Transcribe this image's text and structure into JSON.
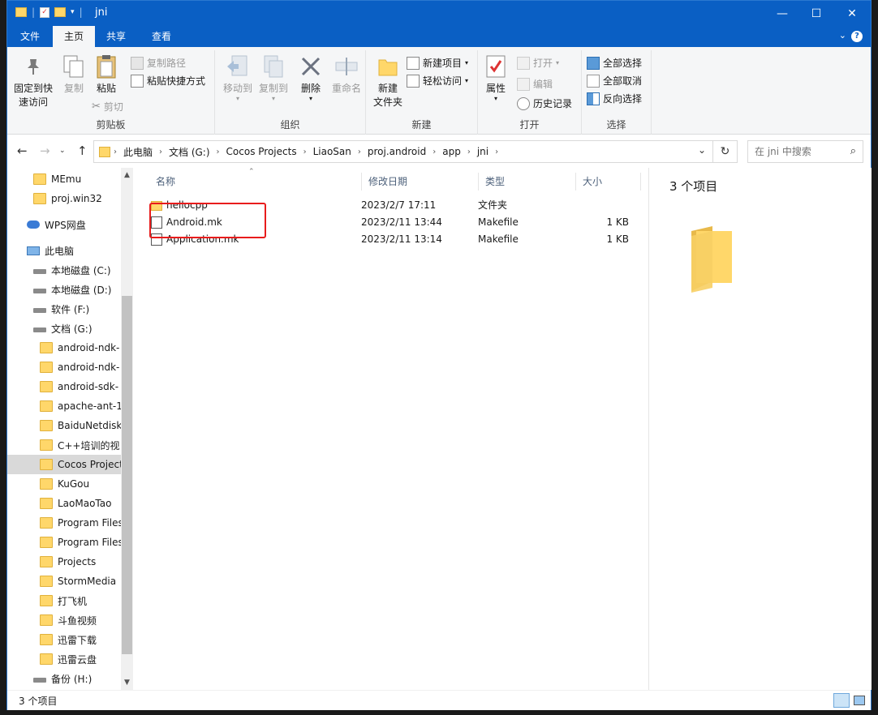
{
  "window": {
    "title": "jni",
    "controls": {
      "minimize": "—",
      "maximize": "☐",
      "close": "✕"
    }
  },
  "menu": {
    "tabs": [
      "文件",
      "主页",
      "共享",
      "查看"
    ],
    "active_tab": "主页"
  },
  "ribbon": {
    "clipboard": {
      "label": "剪贴板",
      "pin": "固定到快\n速访问",
      "pin_line1": "固定到快",
      "pin_line2": "速访问",
      "copy": "复制",
      "paste": "粘贴",
      "copy_path": "复制路径",
      "paste_shortcut": "粘贴快捷方式",
      "cut": "剪切"
    },
    "organize": {
      "label": "组织",
      "move_to": "移动到",
      "copy_to": "复制到",
      "delete": "删除",
      "rename": "重命名"
    },
    "new": {
      "label": "新建",
      "new_folder_line1": "新建",
      "new_folder_line2": "文件夹",
      "new_item": "新建项目",
      "easy_access": "轻松访问"
    },
    "open": {
      "label": "打开",
      "properties": "属性",
      "open": "打开",
      "edit": "编辑",
      "history": "历史记录"
    },
    "select": {
      "label": "选择",
      "select_all": "全部选择",
      "select_none": "全部取消",
      "invert": "反向选择"
    }
  },
  "address": {
    "breadcrumbs": [
      "此电脑",
      "文档 (G:)",
      "Cocos Projects",
      "LiaoSan",
      "proj.android",
      "app",
      "jni"
    ],
    "search_placeholder": "在 jni 中搜索"
  },
  "navpane": {
    "items": [
      {
        "label": "MEmu",
        "type": "folder",
        "indent": 1
      },
      {
        "label": "proj.win32",
        "type": "folder",
        "indent": 1
      },
      {
        "label": "WPS网盘",
        "type": "cloud",
        "indent": 0
      },
      {
        "label": "此电脑",
        "type": "pc",
        "indent": 0
      },
      {
        "label": "本地磁盘 (C:)",
        "type": "drive",
        "indent": 1
      },
      {
        "label": "本地磁盘 (D:)",
        "type": "drive",
        "indent": 1
      },
      {
        "label": "软件 (F:)",
        "type": "drive",
        "indent": 1
      },
      {
        "label": "文档 (G:)",
        "type": "drive",
        "indent": 1
      },
      {
        "label": "android-ndk-",
        "type": "folder",
        "indent": 2
      },
      {
        "label": "android-ndk-",
        "type": "folder",
        "indent": 2
      },
      {
        "label": "android-sdk-",
        "type": "folder",
        "indent": 2
      },
      {
        "label": "apache-ant-1",
        "type": "folder",
        "indent": 2
      },
      {
        "label": "BaiduNetdisk",
        "type": "folder",
        "indent": 2
      },
      {
        "label": "C++培训的视",
        "type": "folder",
        "indent": 2
      },
      {
        "label": "Cocos Project",
        "type": "folder",
        "indent": 2,
        "selected": true
      },
      {
        "label": "KuGou",
        "type": "folder",
        "indent": 2
      },
      {
        "label": "LaoMaoTao",
        "type": "folder",
        "indent": 2
      },
      {
        "label": "Program Files",
        "type": "folder",
        "indent": 2
      },
      {
        "label": "Program Files",
        "type": "folder",
        "indent": 2
      },
      {
        "label": "Projects",
        "type": "folder",
        "indent": 2
      },
      {
        "label": "StormMedia",
        "type": "folder",
        "indent": 2
      },
      {
        "label": "打飞机",
        "type": "folder",
        "indent": 2
      },
      {
        "label": "斗鱼视频",
        "type": "folder",
        "indent": 2
      },
      {
        "label": "迅雷下载",
        "type": "folder",
        "indent": 2
      },
      {
        "label": "迅雷云盘",
        "type": "folder",
        "indent": 2
      },
      {
        "label": "备份 (H:)",
        "type": "drive",
        "indent": 1
      }
    ]
  },
  "filelist": {
    "columns": [
      "名称",
      "修改日期",
      "类型",
      "大小"
    ],
    "rows": [
      {
        "name": "hellocpp",
        "date": "2023/2/7 17:11",
        "type": "文件夹",
        "size": "",
        "icon": "folder-icon"
      },
      {
        "name": "Android.mk",
        "date": "2023/2/11 13:44",
        "type": "Makefile",
        "size": "1 KB",
        "icon": "makefile-icon"
      },
      {
        "name": "Application.mk",
        "date": "2023/2/11 13:14",
        "type": "Makefile",
        "size": "1 KB",
        "icon": "makefile-icon"
      }
    ]
  },
  "preview": {
    "count": "3 个项目"
  },
  "status": {
    "text": "3 个项目"
  },
  "colors": {
    "titlebar": "#0a5fc4",
    "highlight_box": "#e81c1c",
    "folder": "#ffd76a"
  }
}
